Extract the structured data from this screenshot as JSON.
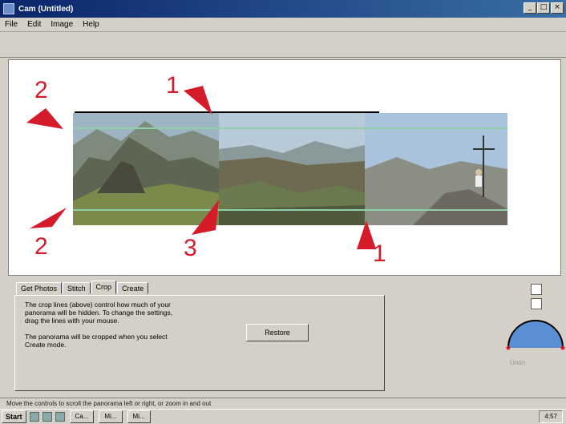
{
  "window": {
    "title": "Cam (Untitled)",
    "controls": [
      "_",
      "□",
      "×"
    ]
  },
  "menu": [
    "File",
    "Edit",
    "Image",
    "Help"
  ],
  "annotations": {
    "top_left": "2",
    "bottom_left": "2",
    "top_center": "1",
    "bottom_center": "3",
    "bottom_right": "1"
  },
  "tabs": [
    {
      "label": "Get Photos",
      "active": false
    },
    {
      "label": "Stitch",
      "active": false
    },
    {
      "label": "Crop",
      "active": true
    },
    {
      "label": "Create",
      "active": false
    }
  ],
  "crop_panel": {
    "description_1": "The crop lines (above) control how much of your panorama will be hidden. To change the settings, drag the lines with your mouse.",
    "description_2": "The panorama will be cropped when you select Create mode.",
    "reset_button": "Restore"
  },
  "side_label": "Undo",
  "status_text": "Move the controls to scroll the panorama left or right, or zoom in and out",
  "taskbar": {
    "start": "Start",
    "tasks": [
      "Ca...",
      "Mi...",
      "Mi..."
    ],
    "clock": "4:57"
  },
  "colors": {
    "title_bar": "#0a246a",
    "annotation_red": "#d51a2a",
    "face_gray": "#d4d0c8"
  }
}
